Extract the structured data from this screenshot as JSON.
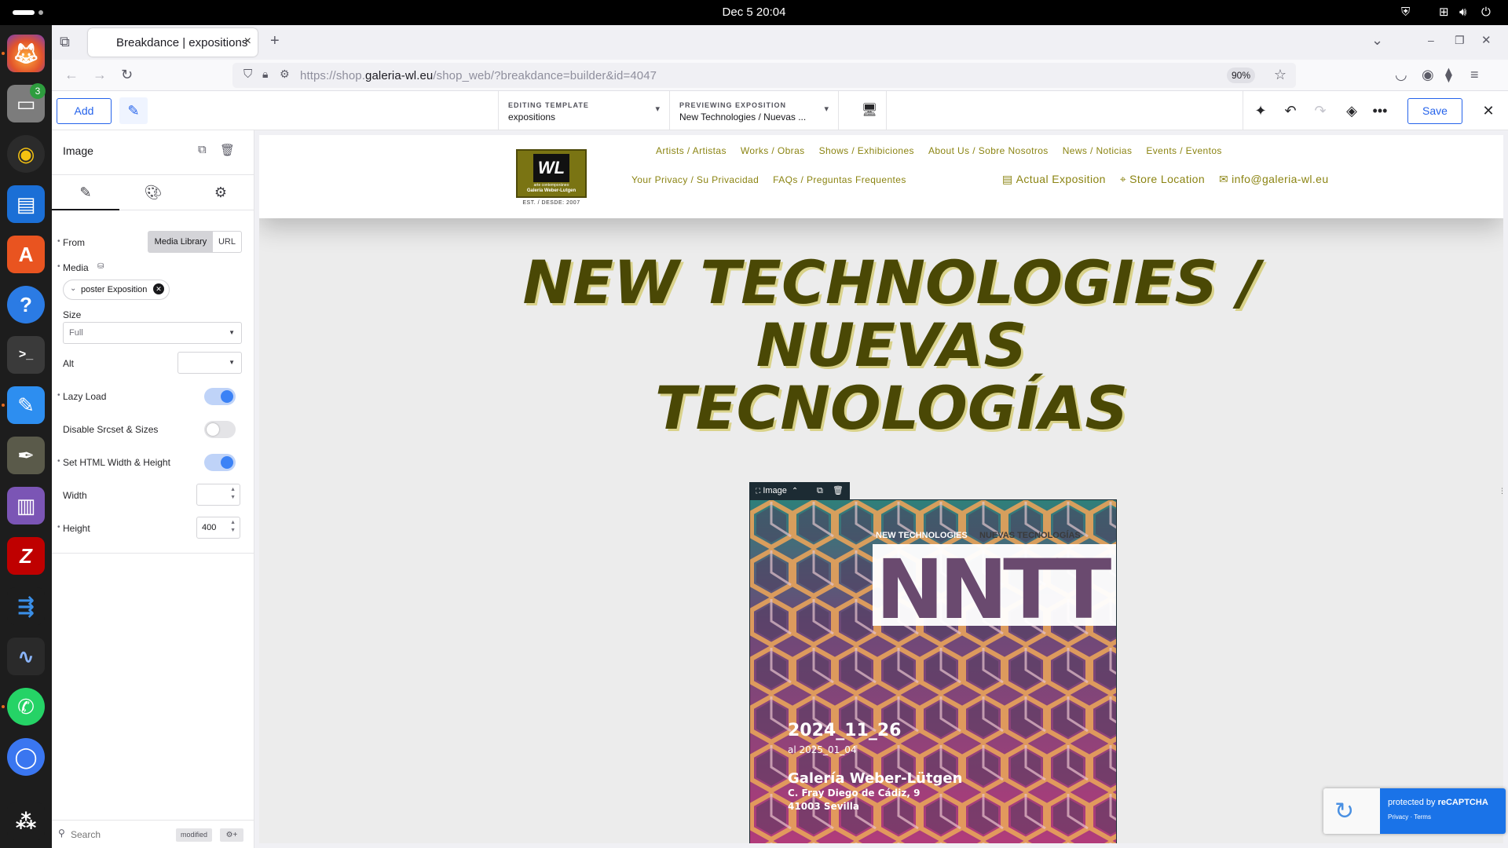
{
  "system": {
    "clock": "Dec 5  20:04"
  },
  "dock": {
    "files_badge": "3"
  },
  "browser": {
    "tab_title": "Breakdance | expositions",
    "url_prefix": "https://shop.",
    "url_domain": "galeria-wl.eu",
    "url_path": "/shop_web/?breakdance=builder&id=4047",
    "zoom": "90%"
  },
  "builder": {
    "add_label": "Add",
    "editing_template_label": "EDITING TEMPLATE",
    "editing_template_value": "expositions",
    "previewing_label": "PREVIEWING EXPOSITION",
    "previewing_value": "New Technologies / Nuevas ...",
    "save_label": "Save"
  },
  "panel": {
    "element_title": "Image",
    "from_label": "From",
    "from_options": [
      "Media Library",
      "URL"
    ],
    "media_label": "Media",
    "media_value": "poster Exposition",
    "size_label": "Size",
    "size_value": "Full",
    "alt_label": "Alt",
    "alt_value": "",
    "lazy_load_label": "Lazy Load",
    "lazy_load": true,
    "disable_srcset_label": "Disable Srcset & Sizes",
    "disable_srcset": false,
    "set_html_wh_label": "Set HTML Width & Height",
    "set_html_wh": true,
    "width_label": "Width",
    "width_value": "",
    "height_label": "Height",
    "height_value": "400",
    "search_placeholder": "Search",
    "modified_label": "modified"
  },
  "site": {
    "logo_text": "WL",
    "logo_sub1": "arte contemporáneo",
    "logo_sub2": "Galería Weber-Lutgen",
    "est": "EST. / DESDE: 2007",
    "nav_row1": [
      "Artists / Artistas",
      "Works / Obras",
      "Shows / Exhibiciones",
      "About Us / Sobre Nosotros",
      "News / Noticias",
      "Events / Eventos"
    ],
    "nav_row2a": [
      "Your Privacy / Su Privacidad",
      "FAQs / Preguntas Frequentes"
    ],
    "nav_row2b": [
      "Actual Exposition",
      "Store Location",
      "info@galeria-wl.eu"
    ],
    "hero_line1": "NEW TECHNOLOGIES /",
    "hero_line2": "NUEVAS",
    "hero_line3": "TECNOLOGÍAS",
    "selected_badge": "Image"
  },
  "poster": {
    "tag_left": "NEW TECHNOLOGIES",
    "tag_right": "NUEVAS TECNOLOGÍAS",
    "big_text": "NNTT",
    "date_from": "2024_11_26",
    "date_to": "al 2025_01_04",
    "gallery": "Galería Weber-Lütgen",
    "address1": "C. Fray Diego de Cádiz, 9",
    "address2": "41003 Sevilla"
  },
  "recaptcha": {
    "line1": "protected by ",
    "line1_bold": "reCAPTCHA",
    "links": "Privacy · Terms"
  },
  "colors": {
    "accent": "#2563eb",
    "site_olive": "#8b8412",
    "hero_text": "#4a4805"
  }
}
